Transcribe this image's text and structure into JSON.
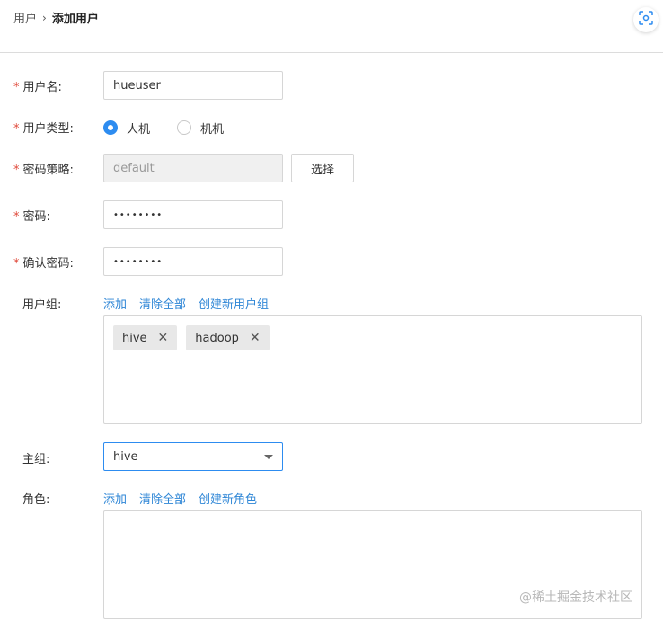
{
  "breadcrumb": {
    "parent": "用户",
    "separator": "›",
    "current": "添加用户"
  },
  "form": {
    "username": {
      "label": "用户名:",
      "value": "hueuser"
    },
    "user_type": {
      "label": "用户类型:",
      "options": [
        "人机",
        "机机"
      ],
      "selected": "人机"
    },
    "password_policy": {
      "label": "密码策略:",
      "placeholder": "default",
      "button": "选择"
    },
    "password": {
      "label": "密码:",
      "value": "••••••••"
    },
    "confirm_password": {
      "label": "确认密码:",
      "value": "••••••••"
    },
    "user_groups": {
      "label": "用户组:",
      "actions": [
        "添加",
        "清除全部",
        "创建新用户组"
      ],
      "tags": [
        "hive",
        "hadoop"
      ]
    },
    "primary_group": {
      "label": "主组:",
      "value": "hive"
    },
    "roles": {
      "label": "角色:",
      "actions": [
        "添加",
        "清除全部",
        "创建新角色"
      ]
    }
  },
  "watermark": "@稀土掘金技术社区",
  "colors": {
    "accent": "#2d8cf0",
    "link": "#2e86d6",
    "required": "#e0493a"
  }
}
